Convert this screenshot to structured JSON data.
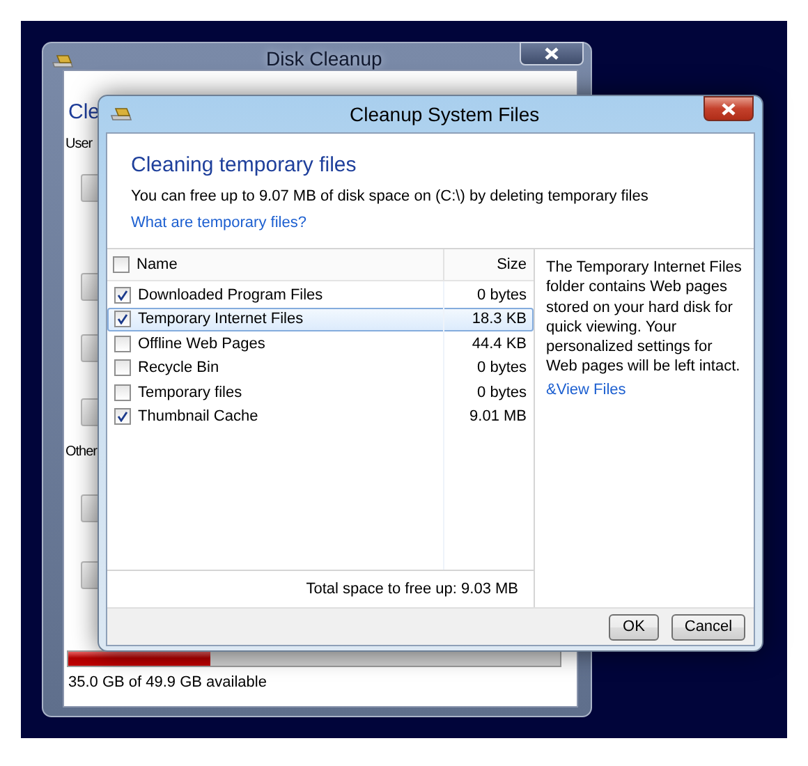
{
  "back_window": {
    "title": "Disk Cleanup",
    "heading": "Cle",
    "section_1": "User",
    "section_2": "Other",
    "disk_usage": {
      "level": 0.29
    },
    "disk_text": "35.0 GB of 49.9 GB available"
  },
  "dialog": {
    "title": "Cleanup System Files",
    "heading": "Cleaning temporary files",
    "description": "You can free up to 9.07 MB of disk space on (C:\\) by deleting temporary files",
    "help_link": "What are temporary files?",
    "columns": [
      {
        "label": "Name",
        "checked": false
      },
      {
        "label": "Size"
      }
    ],
    "rows": [
      {
        "name": "Downloaded Program Files",
        "size": "0 bytes",
        "checked": true,
        "selected": false
      },
      {
        "name": "Temporary Internet Files",
        "size": "18.3 KB",
        "checked": true,
        "selected": true
      },
      {
        "name": "Offline Web Pages",
        "size": "44.4 KB",
        "checked": false,
        "selected": false
      },
      {
        "name": "Recycle Bin",
        "size": "0 bytes",
        "checked": false,
        "selected": false
      },
      {
        "name": "Temporary files",
        "size": "0 bytes",
        "checked": false,
        "selected": false
      },
      {
        "name": "Thumbnail Cache",
        "size": "9.01 MB",
        "checked": true,
        "selected": false
      }
    ],
    "total": "Total space to free up: 9.03 MB",
    "details": "The Temporary Internet Files folder contains Web pages stored on your hard disk for quick viewing. Your personalized settings for Web pages will be left intact.",
    "view_link": "&View Files",
    "buttons": [
      "OK",
      "Cancel"
    ]
  }
}
